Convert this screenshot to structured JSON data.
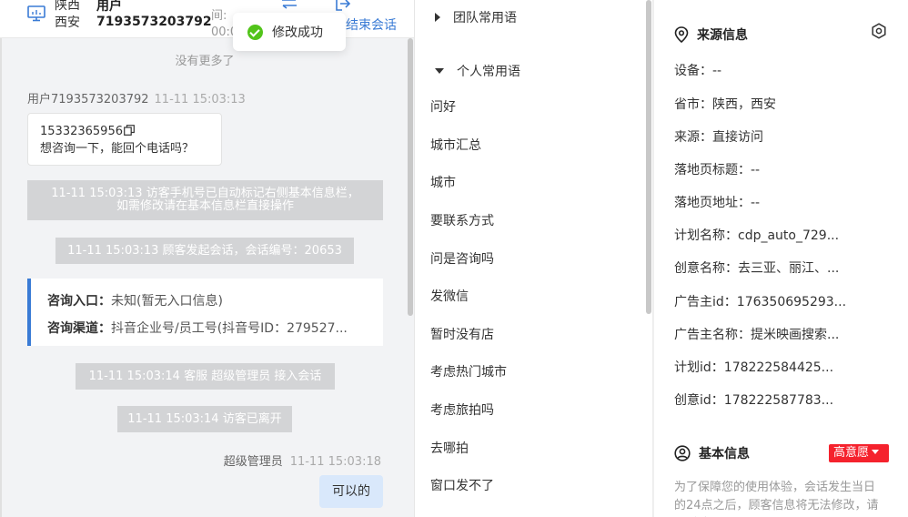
{
  "chat": {
    "header": {
      "location_line1": "陕西",
      "location_line2": "西安",
      "user_line1": "用户",
      "user_line2": "7193573203792",
      "time_label": "间:",
      "time_value": "00:0",
      "end_session_label": "结束会话"
    },
    "toast": {
      "text": "修改成功"
    },
    "no_more": "没有更多了",
    "incoming": {
      "sender": "用户7193573203792",
      "time": "11-11 15:03:13",
      "phone": "15332365956",
      "text": "想咨询一下，能回个电话吗？"
    },
    "system_messages": [
      {
        "line1": "11-11 15:03:13 访客手机号已自动标记右侧基本信息栏，",
        "line2": "如需修改请在基本信息栏直接操作"
      },
      {
        "line1": "11-11 15:03:13 顾客发起会话，会话编号：20653"
      },
      {
        "line1": "11-11 15:03:14 客服 超级管理员 接入会话"
      },
      {
        "line1": "11-11 15:03:14 访客已离开"
      }
    ],
    "entry_card": {
      "entry_label": "咨询入口：",
      "entry_value": "未知(暂无入口信息)",
      "channel_label": "咨询渠道：",
      "channel_value": "抖音企业号/员工号(抖音号ID：279527..."
    },
    "outgoing": {
      "sender": "超级管理员",
      "time": "11-11 15:03:18",
      "text": "可以的"
    }
  },
  "phrases": {
    "groups": [
      {
        "label": "团队常用语",
        "expanded": false
      },
      {
        "label": "个人常用语",
        "expanded": true
      }
    ],
    "items": [
      "问好",
      "城市汇总",
      "城市",
      "要联系方式",
      "问是咨询吗",
      "发微信",
      "暂时没有店",
      "考虑热门城市",
      "考虑旅拍吗",
      "去哪拍",
      "窗口发不了"
    ]
  },
  "info": {
    "source_title": "来源信息",
    "fields": [
      {
        "label": "设备：",
        "value": "--"
      },
      {
        "label": "省市：",
        "value": "陕西，西安"
      },
      {
        "label": "来源：",
        "value": "直接访问"
      },
      {
        "label": "落地页标题：",
        "value": "--"
      },
      {
        "label": "落地页地址：",
        "value": "--"
      },
      {
        "label": "计划名称：",
        "value": "cdp_auto_729..."
      },
      {
        "label": "创意名称：",
        "value": "去三亚、丽江、..."
      },
      {
        "label": "广告主id：",
        "value": "176350695293..."
      },
      {
        "label": "广告主名称：",
        "value": "提米映画搜索..."
      },
      {
        "label": "计划id：",
        "value": "178222584425..."
      },
      {
        "label": "创意id：",
        "value": "178222587783..."
      }
    ],
    "basic_title": "基本信息",
    "intent_badge": "高意愿",
    "notice": "为了保障您的使用体验，会话发生当日的24点之后，顾客信息将无法修改，请及时填写"
  },
  "colors": {
    "accent_blue": "#3a7bd5",
    "success_green": "#52c41a",
    "badge_red": "#f5222d",
    "system_msg_gray": "#d3d4d6",
    "outgoing_bubble": "#d9e8fb"
  }
}
